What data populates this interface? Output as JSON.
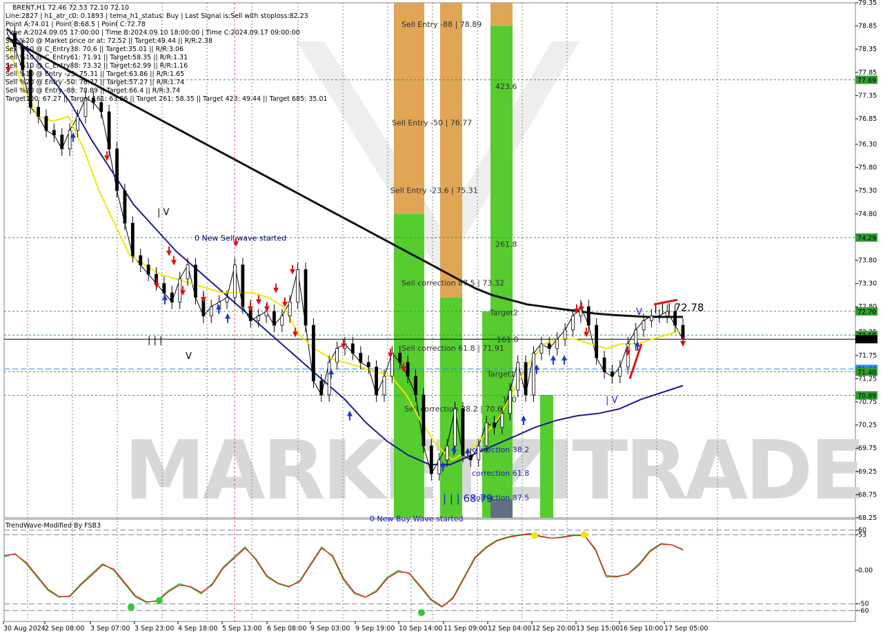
{
  "header": {
    "symbol_line": "BRENT,H1  72.46 72.53 72.10 72.10",
    "info_lines": [
      "Line:2827  |  h1_atr_c0: 0.1893  |  tema_h1_status: Buy  |  Last Signal is:Sell with stoploss:82.23",
      "Point A:74.01  |  Point B:68.5  |  Point C:72.78",
      "Time A:2024.09.05 17:00:00  |  Time B:2024.09.10 18:00:00  |  Time C:2024.09.17 09:00:00",
      "Sell %20 @ Market price or at: 72.52  ||  Target:49.44  ||  R/R:2.38",
      "Sell %10 @ C_Entry38: 70.6  ||  Target:35.01  ||  R/R:3.06",
      "Sell %10 @ C_Entry61: 71.91  ||  Target:58.35  ||  R/R:1.31",
      "Sell %10 @ C_Entry88: 73.32  ||  Target:62.99  ||  R/R:1.16",
      "Sell %10 @ Entry -23: 75.31  ||  Target:63.86  ||  R/R:1.65",
      "Sell %20 @ Entry -50: 76.77  ||  Target:57.27  ||  R/R:1.74",
      "Sell %20 @ Entry -88: 78.89  ||  Target:66.4  ||  R/R:3.74",
      "Target100: 67.27  ||  Target 161: 63.86  ||  Target 261: 58.35  ||  Target 423: 49.44  ||  Target 685: 35.01"
    ]
  },
  "watermark": "MARKETZITRADE",
  "chart_data": [
    {
      "type": "line",
      "title": "BRENT,H1",
      "ylim": [
        68.25,
        79.35
      ],
      "y_ticks": [
        79.35,
        78.85,
        78.35,
        77.85,
        77.35,
        76.85,
        76.3,
        75.8,
        75.3,
        74.8,
        74.3,
        73.8,
        73.3,
        72.8,
        72.25,
        71.75,
        71.25,
        70.75,
        70.25,
        69.75,
        69.25,
        68.75,
        68.25
      ],
      "x_labels": [
        "30 Aug 2024",
        "2 Sep 08:00",
        "3 Sep 07:00",
        "3 Sep 23:00",
        "4 Sep 18:00",
        "5 Sep 13:00",
        "6 Sep 08:00",
        "9 Sep 03:00",
        "9 Sep 19:00",
        "10 Sep 14:00",
        "11 Sep 09:00",
        "12 Sep 04:00",
        "12 Sep 20:00",
        "13 Sep 15:00",
        "16 Sep 10:00",
        "17 Sep 05:00"
      ],
      "price_tags": [
        {
          "value": 77.69,
          "label": "77.69",
          "color": "#2e9e2e"
        },
        {
          "value": 74.29,
          "label": "74.29",
          "color": "#2e9e2e"
        },
        {
          "value": 72.7,
          "label": "72.70",
          "color": "#2e9e2e"
        },
        {
          "value": 72.19,
          "label": "72.19",
          "color": "#2e9e2e"
        },
        {
          "value": 72.1,
          "label": "72.10",
          "color": "#000000"
        },
        {
          "value": 71.46,
          "label": "71.46",
          "color": "#1e90ff"
        },
        {
          "value": 71.4,
          "label": "71.40",
          "color": "#2e9e2e"
        },
        {
          "value": 70.89,
          "label": "70.89",
          "color": "#2e9e2e"
        }
      ],
      "zone_labels": [
        {
          "text": "Sell Entry -88 | 78.89",
          "value": 78.89
        },
        {
          "text": "423.6",
          "value": 77.55
        },
        {
          "text": "Sell Entry -50 | 76.77",
          "value": 76.77
        },
        {
          "text": "Sell Entry -23.6 | 75.31",
          "value": 75.31
        },
        {
          "text": "261.8",
          "value": 74.15
        },
        {
          "text": "Sell correction 87.5 | 73.32",
          "value": 73.32
        },
        {
          "text": "Target2",
          "value": 72.68
        },
        {
          "text": "161.8",
          "value": 72.1
        },
        {
          "text": "Sell correction 61.8 | 71.91",
          "value": 71.91
        },
        {
          "text": "Target1",
          "value": 71.35
        },
        {
          "text": "100",
          "value": 70.8
        },
        {
          "text": "Sell correction 38.2 | 70.6",
          "value": 70.6
        },
        {
          "text": "correction 38.2",
          "value": 69.72
        },
        {
          "text": "correction 61.8",
          "value": 69.22
        },
        {
          "text": "correction 87.5",
          "value": 68.69
        }
      ],
      "wave_labels": [
        {
          "text": "0 New Sell wave started",
          "value": 74.3
        },
        {
          "text": "0 New Buy Wave started",
          "value": 68.25
        },
        {
          "text": "| | | 68.79",
          "value": 68.67
        },
        {
          "text": "| | | 72.78",
          "value": 72.78
        },
        {
          "text": "| V",
          "value": 74.85
        },
        {
          "text": "| | |",
          "value": 72.1
        },
        {
          "text": "V",
          "value": 71.75
        },
        {
          "text": "| V",
          "value": 70.8
        },
        {
          "text": "V",
          "value": 72.7
        }
      ],
      "series": [
        {
          "name": "BRENT",
          "color": "#000000",
          "values": [
            78.7,
            78.4,
            77.9,
            77.1,
            76.9,
            76.6,
            76.5,
            76.2,
            76.6,
            76.9,
            77.3,
            77.2,
            77.0,
            76.2,
            75.3,
            74.6,
            73.9,
            73.7,
            73.5,
            73.3,
            73.1,
            72.9,
            73.4,
            73.7,
            73.0,
            72.6,
            72.8,
            72.9,
            73.0,
            73.7,
            72.8,
            72.5,
            72.6,
            72.7,
            72.4,
            72.6,
            72.9,
            73.6,
            72.4,
            71.2,
            70.9,
            71.6,
            71.9,
            72.0,
            71.8,
            71.6,
            71.5,
            70.9,
            71.3,
            71.8,
            71.6,
            71.3,
            70.9,
            69.8,
            69.2,
            69.5,
            69.8,
            70.6,
            69.6,
            69.5,
            69.8,
            70.3,
            70.2,
            70.5,
            71.0,
            71.6,
            70.9,
            71.8,
            72.0,
            71.9,
            72.1,
            72.3,
            72.6,
            72.8,
            72.4,
            71.7,
            71.4,
            71.3,
            71.5,
            72.0,
            72.3,
            72.5,
            72.6,
            72.6,
            72.7,
            72.4,
            72.1
          ]
        },
        {
          "name": "",
          "color": "#111111",
          "values": [
            78.6,
            78.4,
            78.2,
            78.0,
            77.8,
            77.6,
            77.4,
            77.2,
            77.0,
            76.8,
            76.6,
            76.4,
            76.2,
            76.0,
            75.8,
            75.6,
            75.4,
            75.2,
            75.0,
            74.8,
            74.6,
            74.4,
            74.2,
            74.0,
            73.8,
            73.6,
            73.4,
            73.2,
            73.05,
            72.95,
            72.85,
            72.8,
            72.75,
            72.7,
            72.65,
            72.62,
            72.6,
            72.58,
            72.58,
            72.58
          ]
        },
        {
          "name": "",
          "color": "#1a1a8c",
          "values": [
            78.8,
            78.3,
            77.8,
            77.2,
            76.4,
            75.7,
            75.0,
            74.5,
            74.0,
            73.6,
            73.2,
            72.8,
            72.4,
            72.0,
            71.6,
            71.2,
            70.8,
            70.3,
            69.9,
            69.6,
            69.4,
            69.4,
            69.6,
            69.8,
            70.0,
            70.2,
            70.35,
            70.45,
            70.5,
            70.6,
            70.8,
            70.95,
            71.1
          ]
        },
        {
          "name": "",
          "color": "#f2e600",
          "values": [
            78.5,
            77.6,
            76.9,
            76.8,
            76.9,
            76.2,
            75.3,
            74.6,
            73.9,
            73.7,
            73.5,
            73.4,
            73.3,
            73.2,
            73.1,
            73.1,
            73.1,
            73.0,
            72.8,
            72.2,
            71.9,
            71.7,
            71.6,
            71.5,
            71.4,
            71.3,
            70.9,
            70.3,
            69.8,
            69.5,
            69.7,
            70.0,
            70.4,
            71.0,
            71.6,
            72.0,
            72.1,
            72.1,
            72.0,
            71.9,
            72.0,
            72.0,
            72.1,
            72.2,
            72.3
          ]
        }
      ]
    },
    {
      "type": "line",
      "title": "TrendWave-Modified By FSB3",
      "ylim": [
        -70,
        70
      ],
      "y_ticks": [
        60,
        53,
        0.0,
        -50,
        -60
      ],
      "y_tick_labels": [
        "60",
        "53",
        "0.00",
        "-50",
        "-60"
      ],
      "levels": [
        53,
        60,
        -50,
        -60
      ],
      "series": [
        {
          "name": "",
          "color": "#2ecc2e",
          "values": [
            20,
            25,
            10,
            -10,
            -30,
            -40,
            -38,
            -20,
            -5,
            10,
            0,
            -20,
            -40,
            -48,
            -45,
            -30,
            -20,
            -25,
            -35,
            -20,
            5,
            20,
            35,
            15,
            -10,
            -20,
            -25,
            -15,
            10,
            35,
            20,
            -15,
            -35,
            -40,
            -30,
            -10,
            0,
            -5,
            -25,
            -45,
            -55,
            -40,
            -10,
            20,
            35,
            45,
            50,
            53,
            55,
            50,
            48,
            50,
            53,
            52,
            30,
            -10,
            -10,
            -5,
            10,
            30,
            40,
            38,
            30
          ]
        },
        {
          "name": "",
          "color": "#e02020",
          "values": [
            22,
            24,
            12,
            -8,
            -28,
            -39,
            -39,
            -22,
            -7,
            8,
            2,
            -18,
            -38,
            -47,
            -46,
            -32,
            -22,
            -24,
            -33,
            -22,
            3,
            18,
            33,
            17,
            -8,
            -19,
            -24,
            -17,
            8,
            33,
            22,
            -12,
            -33,
            -40,
            -32,
            -12,
            -2,
            -4,
            -23,
            -43,
            -54,
            -42,
            -12,
            18,
            33,
            44,
            49,
            52,
            54,
            51,
            48,
            49,
            52,
            52,
            32,
            -8,
            -9,
            -6,
            8,
            28,
            39,
            38,
            31
          ]
        }
      ]
    }
  ]
}
